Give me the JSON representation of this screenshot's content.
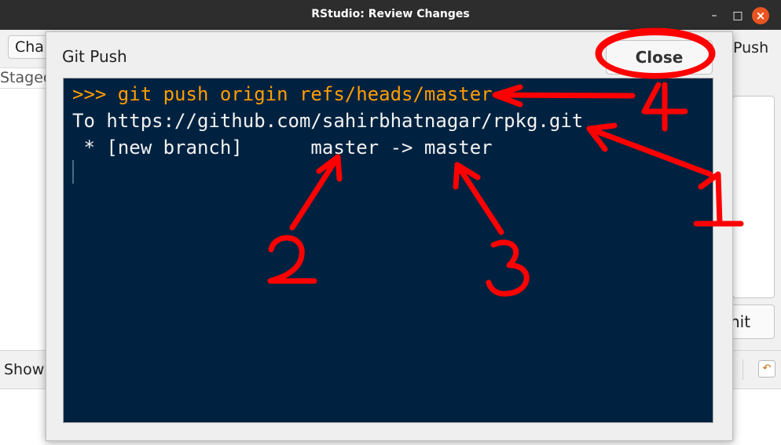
{
  "window": {
    "title": "RStudio: Review Changes",
    "controls": {
      "minimize_icon": "minimize-icon",
      "maximize_icon": "maximize-icon",
      "close_icon": "close-icon"
    }
  },
  "background": {
    "changes_tab_label": "Cha",
    "push_label": "Push",
    "staged_label": "Staged",
    "show_label": "Show",
    "commit_label": "nit",
    "revert_icon": "revert-icon"
  },
  "dialog": {
    "title": "Git Push",
    "close_label": "Close",
    "terminal": {
      "command": ">>> git push origin refs/heads/master",
      "line2": "To https://github.com/sahirbhatnagar/rpkg.git",
      "line3": " * [new branch]      master -> master"
    }
  },
  "annotations": {
    "color": "#ff0000",
    "labels": [
      "1",
      "2",
      "3",
      "4"
    ]
  },
  "colors": {
    "terminal_bg": "#002240",
    "command_text": "#ff9d00",
    "output_text": "#f2f2f2",
    "window_close": "#e95420"
  }
}
